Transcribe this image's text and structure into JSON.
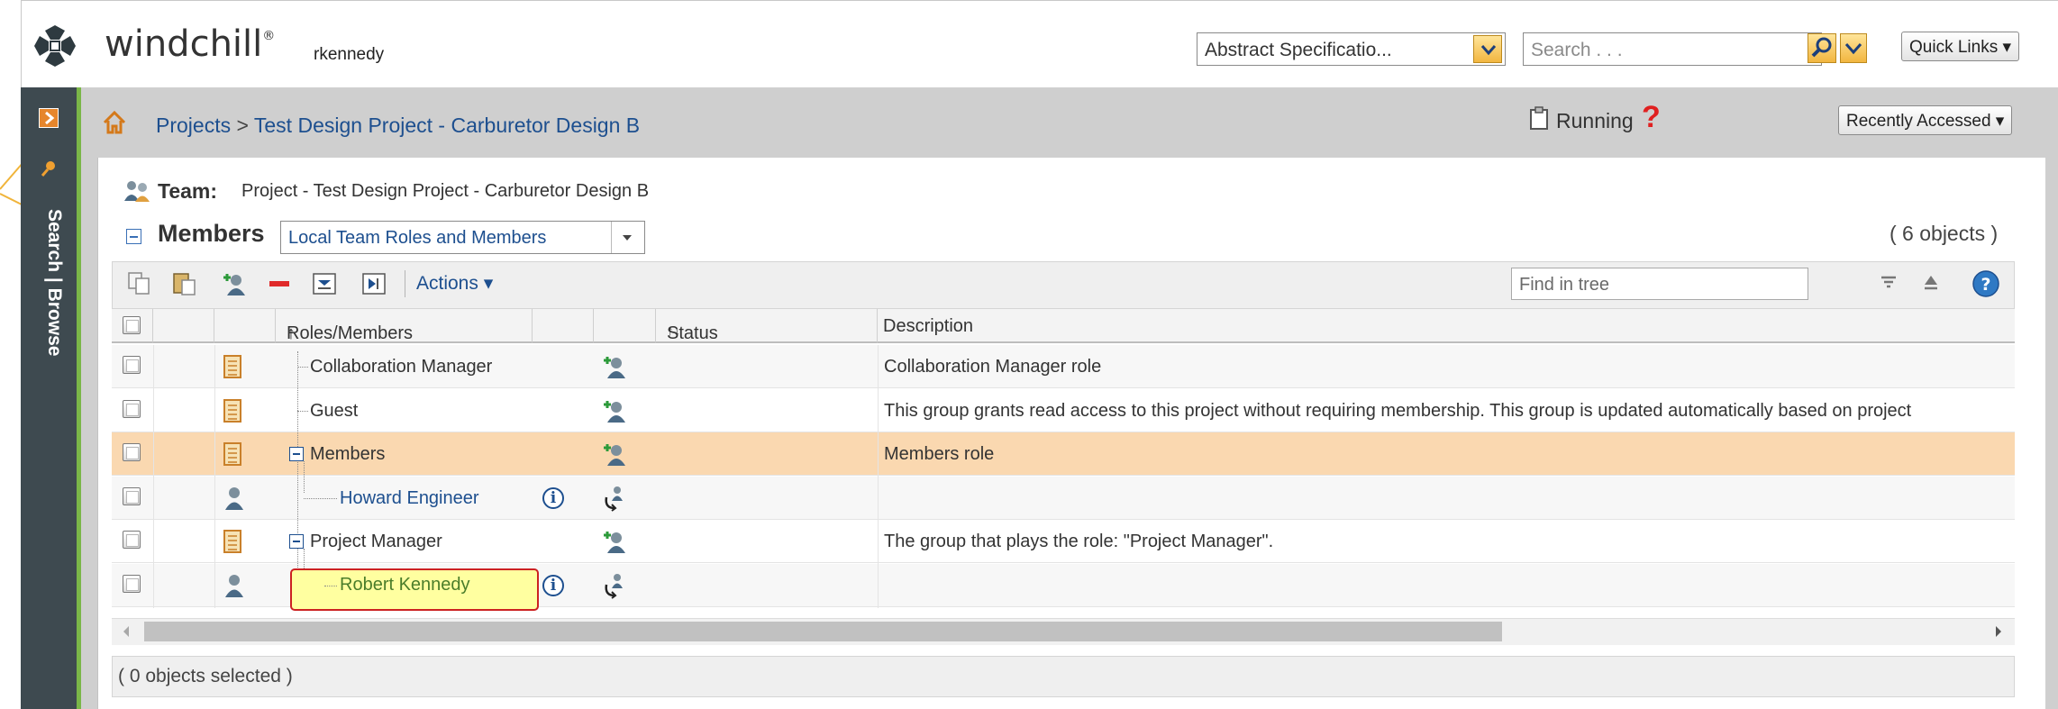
{
  "header": {
    "brand": "windchill",
    "brand_mark": "®",
    "username": "rkennedy",
    "context_select": "Abstract Specificatio...",
    "search_placeholder": "Search . . .",
    "quick_links": "Quick Links"
  },
  "left_rail": {
    "label": "Search | Browse"
  },
  "breadcrumb": {
    "projects": "Projects",
    "separator": " > ",
    "project": "Test Design Project - Carburetor Design B",
    "running_label": "Running",
    "help_mark": "?",
    "recently_accessed": "Recently Accessed"
  },
  "team": {
    "label": "Team:",
    "value": "Project - Test Design Project - Carburetor Design B"
  },
  "members": {
    "label": "Members",
    "view_select": "Local Team Roles and Members",
    "object_count": "( 6 objects )"
  },
  "toolbar": {
    "actions_label": "Actions",
    "find_placeholder": "Find in tree"
  },
  "table": {
    "columns": {
      "roles_members": "Roles/Members",
      "roles_sort": "↑",
      "status": "Status",
      "status_sort": "↑↓",
      "description": "Description"
    },
    "rows": [
      {
        "name": "Collaboration Manager",
        "type": "role",
        "description": "Collaboration Manager role"
      },
      {
        "name": "Guest",
        "type": "role",
        "description": "This group grants read access to this project without requiring membership.  This group is updated automatically based on project"
      },
      {
        "name": "Members",
        "type": "role",
        "description": "Members role"
      },
      {
        "name": "Howard Engineer",
        "type": "user",
        "description": ""
      },
      {
        "name": "Project Manager",
        "type": "role",
        "description": "The group that plays the role: \"Project Manager\"."
      },
      {
        "name": "Robert Kennedy",
        "type": "user",
        "description": ""
      }
    ],
    "info_glyph": "i"
  },
  "footer": {
    "selection_status": "( 0 objects selected )"
  },
  "colors": {
    "link_blue": "#1d4f8f",
    "selected_row": "#fad8b0",
    "highlight_fill": "#ffffa0",
    "highlight_border": "#cc2222",
    "rail_bg": "#3e4a50",
    "accent_green": "#7ab648"
  }
}
